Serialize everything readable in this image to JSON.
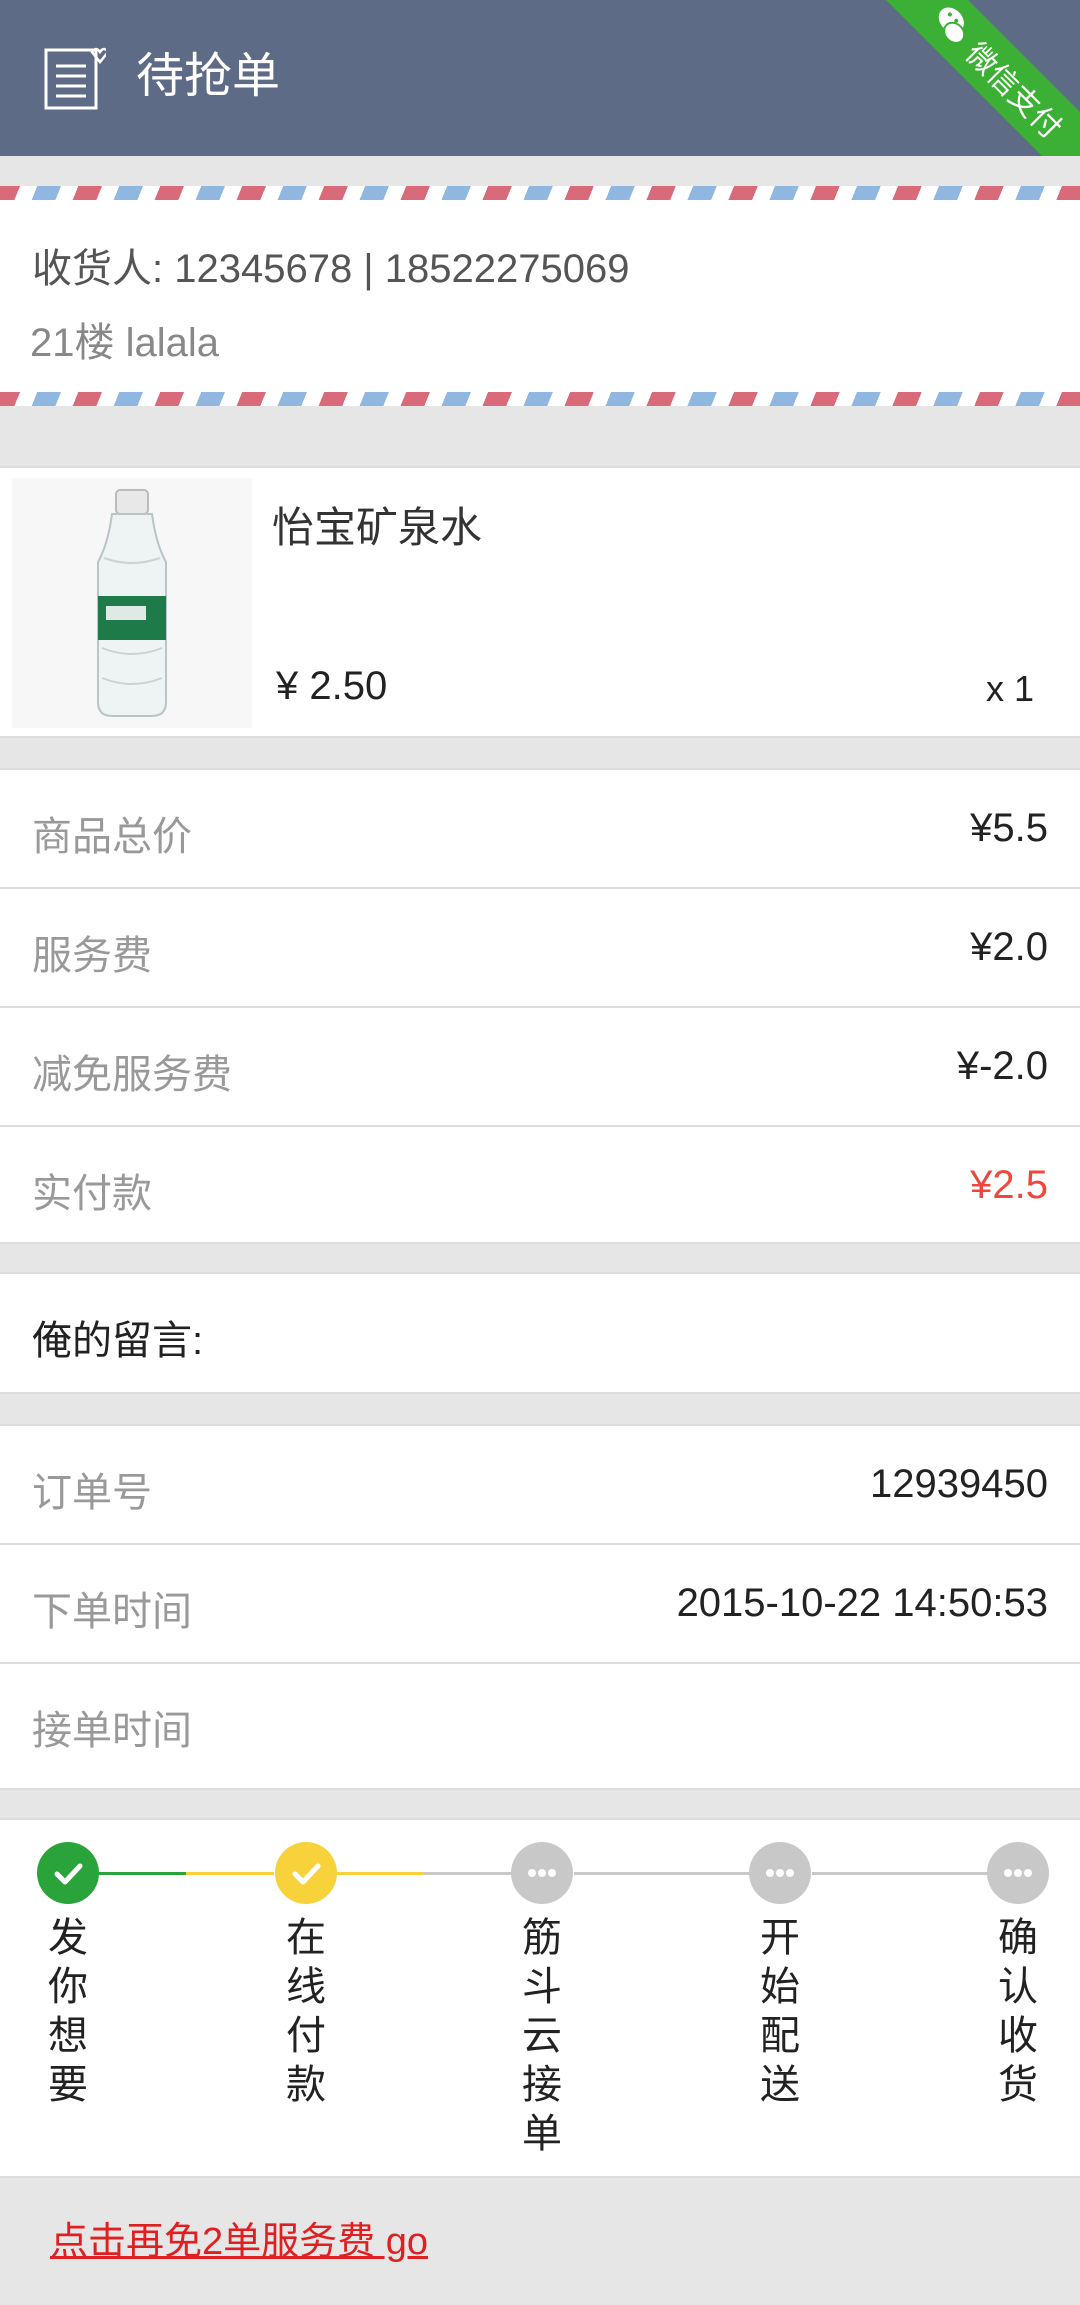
{
  "header": {
    "title": "待抢单",
    "badge": "微信支付",
    "bg_color": "#5d6b86",
    "badge_color": "#3cb034"
  },
  "address": {
    "receiver_line": "收货人: 12345678 | 18522275069",
    "address_line": "21楼 lalala"
  },
  "product": {
    "name": "怡宝矿泉水",
    "price": "¥ 2.50",
    "quantity": "x 1"
  },
  "fees": [
    {
      "label": "商品总价",
      "value": "¥5.5"
    },
    {
      "label": "服务费",
      "value": "¥2.0"
    },
    {
      "label": "减免服务费",
      "value": "¥-2.0"
    },
    {
      "label": "实付款",
      "value": "¥2.5"
    }
  ],
  "message": {
    "label": "俺的留言:"
  },
  "order": [
    {
      "label": "订单号",
      "value": "12939450"
    },
    {
      "label": "下单时间",
      "value": "2015-10-22 14:50:53"
    },
    {
      "label": "接单时间",
      "value": ""
    }
  ],
  "steps": [
    {
      "label": "发你想要",
      "state": "done"
    },
    {
      "label": "在线付款",
      "state": "current"
    },
    {
      "label": "筋斗云接单",
      "state": "pending"
    },
    {
      "label": "开始配送",
      "state": "pending"
    },
    {
      "label": "确认收货",
      "state": "pending"
    }
  ],
  "promo": {
    "text": "点击再免2单服务费 go"
  },
  "colors": {
    "done": "#2aa43a",
    "current": "#f7d23a",
    "pending": "#c8c8c8",
    "total_red": "#f0473c"
  }
}
